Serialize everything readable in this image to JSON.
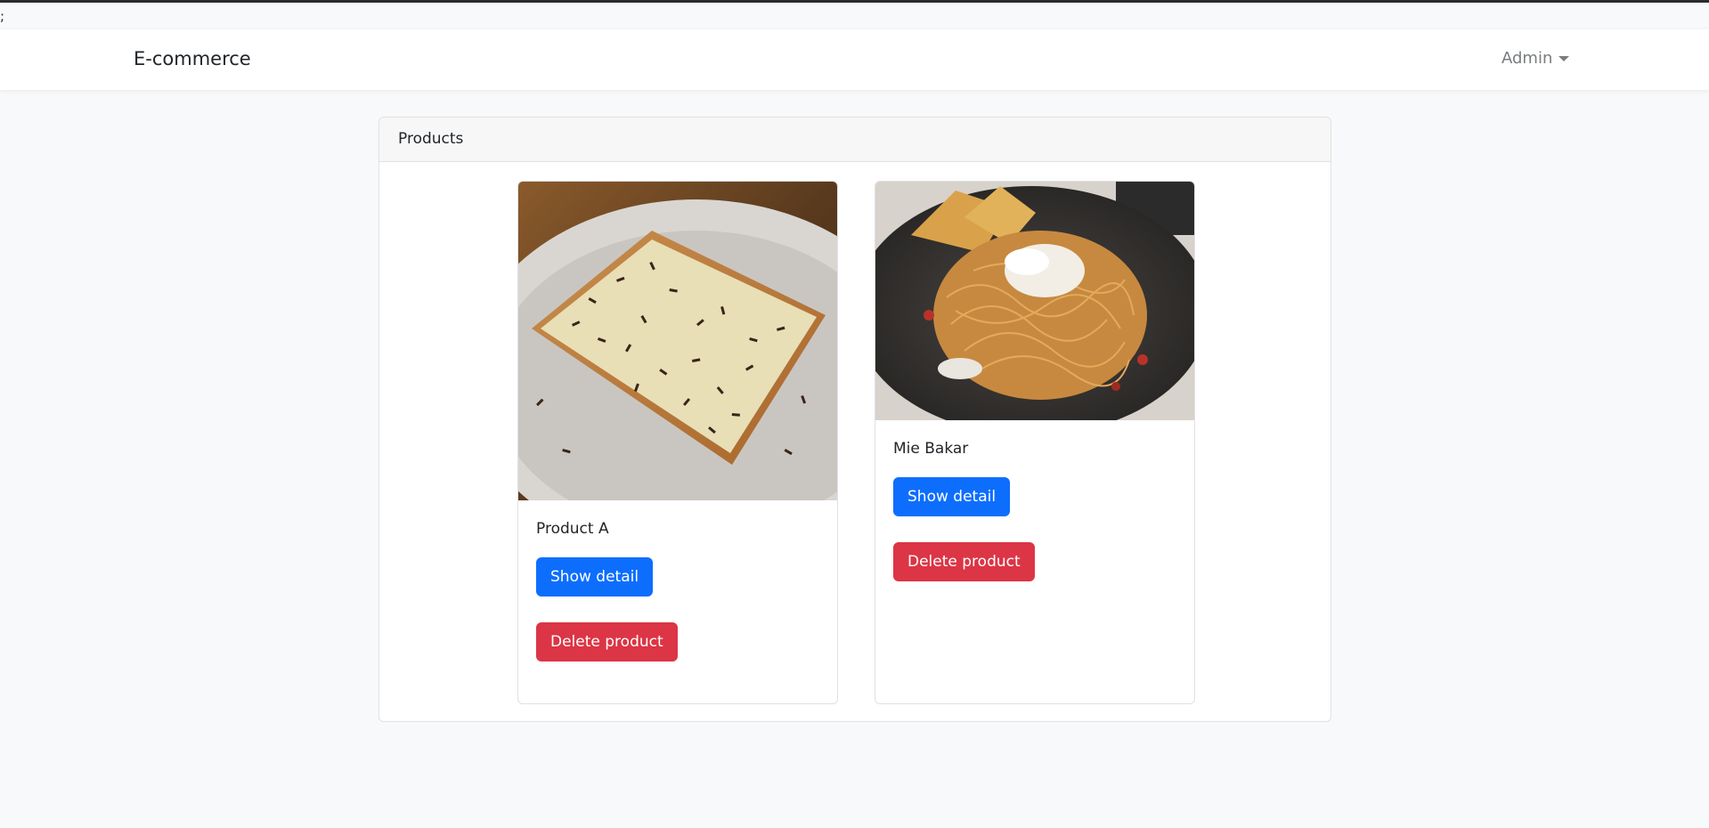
{
  "page": {
    "stray_text": ";"
  },
  "navbar": {
    "brand": "E-commerce",
    "user_menu_label": "Admin",
    "user_menu_icon": "caret-down-icon"
  },
  "panel": {
    "header": "Products"
  },
  "products": [
    {
      "name": "Product A",
      "image_description": "square toast topped with grated cheese and chocolate sprinkles",
      "show_label": "Show detail",
      "delete_label": "Delete product"
    },
    {
      "name": "Mie Bakar",
      "image_description": "plate of grilled noodles with crackers and crumbled cheese",
      "show_label": "Show detail",
      "delete_label": "Delete product"
    }
  ],
  "colors": {
    "primary": "#0d6efd",
    "danger": "#dc3545",
    "background": "#f8f9fa",
    "navbar": "#ffffff"
  }
}
